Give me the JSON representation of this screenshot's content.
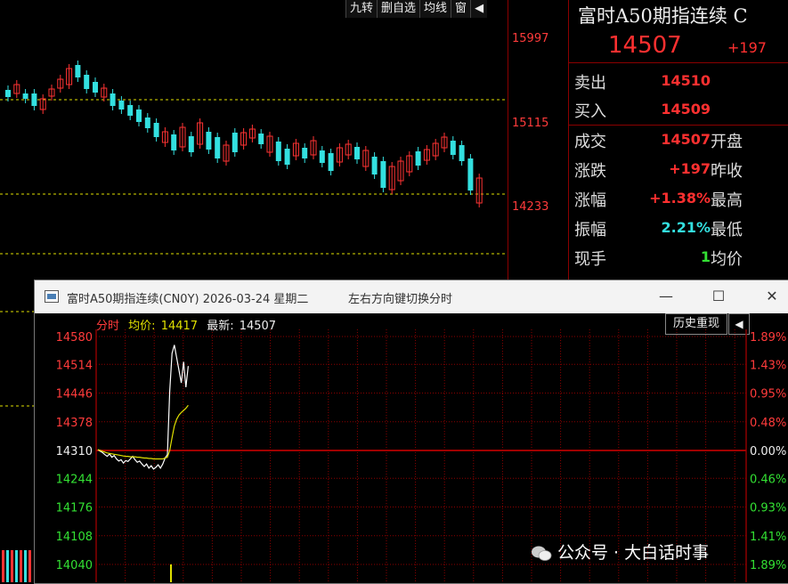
{
  "toolbar": {
    "items": [
      "九转",
      "删自选",
      "均线",
      "窗",
      "◀"
    ]
  },
  "background_chart": {
    "price_labels": [
      "15997",
      "15115",
      "14233"
    ],
    "colors": {
      "up": "#ff3333",
      "down": "#33e0e0",
      "dash": "#e0e000",
      "axis": "#8b0000"
    }
  },
  "quote": {
    "title": "富时A50期指连续 C",
    "price": "14507",
    "change": "+197",
    "rows": [
      {
        "label": "卖出",
        "value": "14510",
        "value_color": "#ff3030",
        "label2": ""
      },
      {
        "label": "买入",
        "value": "14509",
        "value_color": "#ff3030",
        "label2": ""
      },
      {
        "label": "成交",
        "value": "14507",
        "value_color": "#ff3030",
        "label2": "开盘"
      },
      {
        "label": "涨跌",
        "value": "+197",
        "value_color": "#ff3030",
        "label2": "昨收"
      },
      {
        "label": "涨幅",
        "value": "+1.38%",
        "value_color": "#ff3030",
        "label2": "最高"
      },
      {
        "label": "振幅",
        "value": "2.21%",
        "value_color": "#33e0e0",
        "label2": "最低"
      },
      {
        "label": "现手",
        "value": "1",
        "value_color": "#33e033",
        "label2": "均价"
      }
    ]
  },
  "window": {
    "title": "富时A50期指连续(CN0Y) 2026-03-24 星期二",
    "hint": "左右方向键切换分时",
    "controls": {
      "minimize": "—",
      "maximize": "☐",
      "close": "✕"
    }
  },
  "tick_info": {
    "label_mode": "分时",
    "avg_label": "均价:",
    "avg_value": "14417",
    "last_label": "最新:",
    "last_value": "14507"
  },
  "history_button": "历史重现",
  "back_button": "◀",
  "watermark": "公众号 · 大白话时事",
  "chart_data": {
    "type": "line",
    "title": "",
    "left_axis": [
      "14580",
      "14514",
      "14446",
      "14378",
      "14310",
      "14244",
      "14176",
      "14108",
      "14040"
    ],
    "right_axis": [
      "1.89%",
      "1.43%",
      "0.95%",
      "0.48%",
      "0.00%",
      "0.46%",
      "0.93%",
      "1.41%",
      "1.89%"
    ],
    "y_prices": [
      14580,
      14514,
      14446,
      14378,
      14310,
      14244,
      14176,
      14108,
      14040
    ],
    "baseline": 14310,
    "ylim": [
      14040,
      14580
    ],
    "series": [
      {
        "values": [
          14312,
          14308,
          14305,
          14300,
          14296,
          14302,
          14294,
          14298,
          14290,
          14285,
          14288,
          14280,
          14286,
          14284,
          14290,
          14296,
          14288,
          14282,
          14285,
          14278,
          14272,
          14278,
          14268,
          14274,
          14266,
          14270,
          14276,
          14268,
          14278,
          14292,
          14300,
          14450,
          14540,
          14560,
          14530,
          14500,
          14470,
          14520,
          14460,
          14510
        ]
      },
      {
        "values": [
          14312,
          14310,
          14308,
          14306,
          14304,
          14303,
          14302,
          14301,
          14300,
          14299,
          14298,
          14297,
          14296,
          14296,
          14295,
          14295,
          14295,
          14294,
          14294,
          14293,
          14292,
          14292,
          14291,
          14291,
          14290,
          14290,
          14290,
          14290,
          14290,
          14292,
          14294,
          14310,
          14340,
          14368,
          14384,
          14394,
          14400,
          14405,
          14410,
          14417
        ]
      }
    ]
  }
}
